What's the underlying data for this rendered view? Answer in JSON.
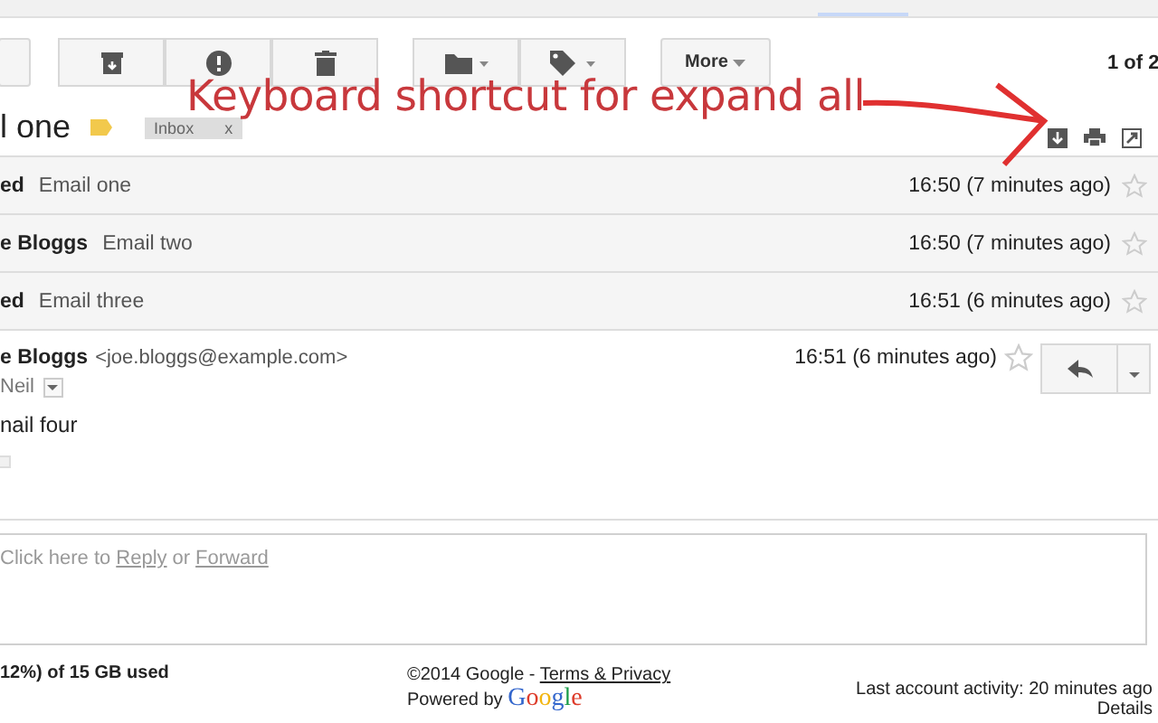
{
  "toolbar": {
    "groups": [
      [
        {
          "kind": "archive"
        },
        {
          "kind": "spam"
        },
        {
          "kind": "delete"
        }
      ],
      [
        {
          "kind": "folder"
        },
        {
          "kind": "label"
        }
      ]
    ],
    "more": "More",
    "pager": "1 of 2"
  },
  "subject": {
    "text": "l one",
    "label": "Inbox",
    "remove": "x"
  },
  "annotation": {
    "text": "Keyboard shortcut for expand all"
  },
  "messages": [
    {
      "sender": "ed",
      "snippet": "Email one",
      "time": "16:50 (7 minutes ago)",
      "starred": false
    },
    {
      "sender": "e Bloggs",
      "snippet": "Email two",
      "time": "16:50 (7 minutes ago)",
      "starred": false
    },
    {
      "sender": "ed",
      "snippet": "Email three",
      "time": "16:51 (6 minutes ago)",
      "starred": false
    }
  ],
  "open_message": {
    "sender": "e Bloggs",
    "email": "<joe.bloggs@example.com>",
    "time": "16:51 (6 minutes ago)",
    "starred": false,
    "to": "Neil",
    "body": "nail four"
  },
  "reply_box": {
    "prefix": "Click here to",
    "reply": "Reply",
    "or": "or",
    "forward": "Forward"
  },
  "footer": {
    "storage": "12%) of 15 GB used",
    "copyright": "©2014 Google -",
    "terms": "Terms & Privacy",
    "powered": "Powered by",
    "logo": "Google",
    "activity": "Last account activity: 20 minutes ago",
    "details": "Details"
  }
}
